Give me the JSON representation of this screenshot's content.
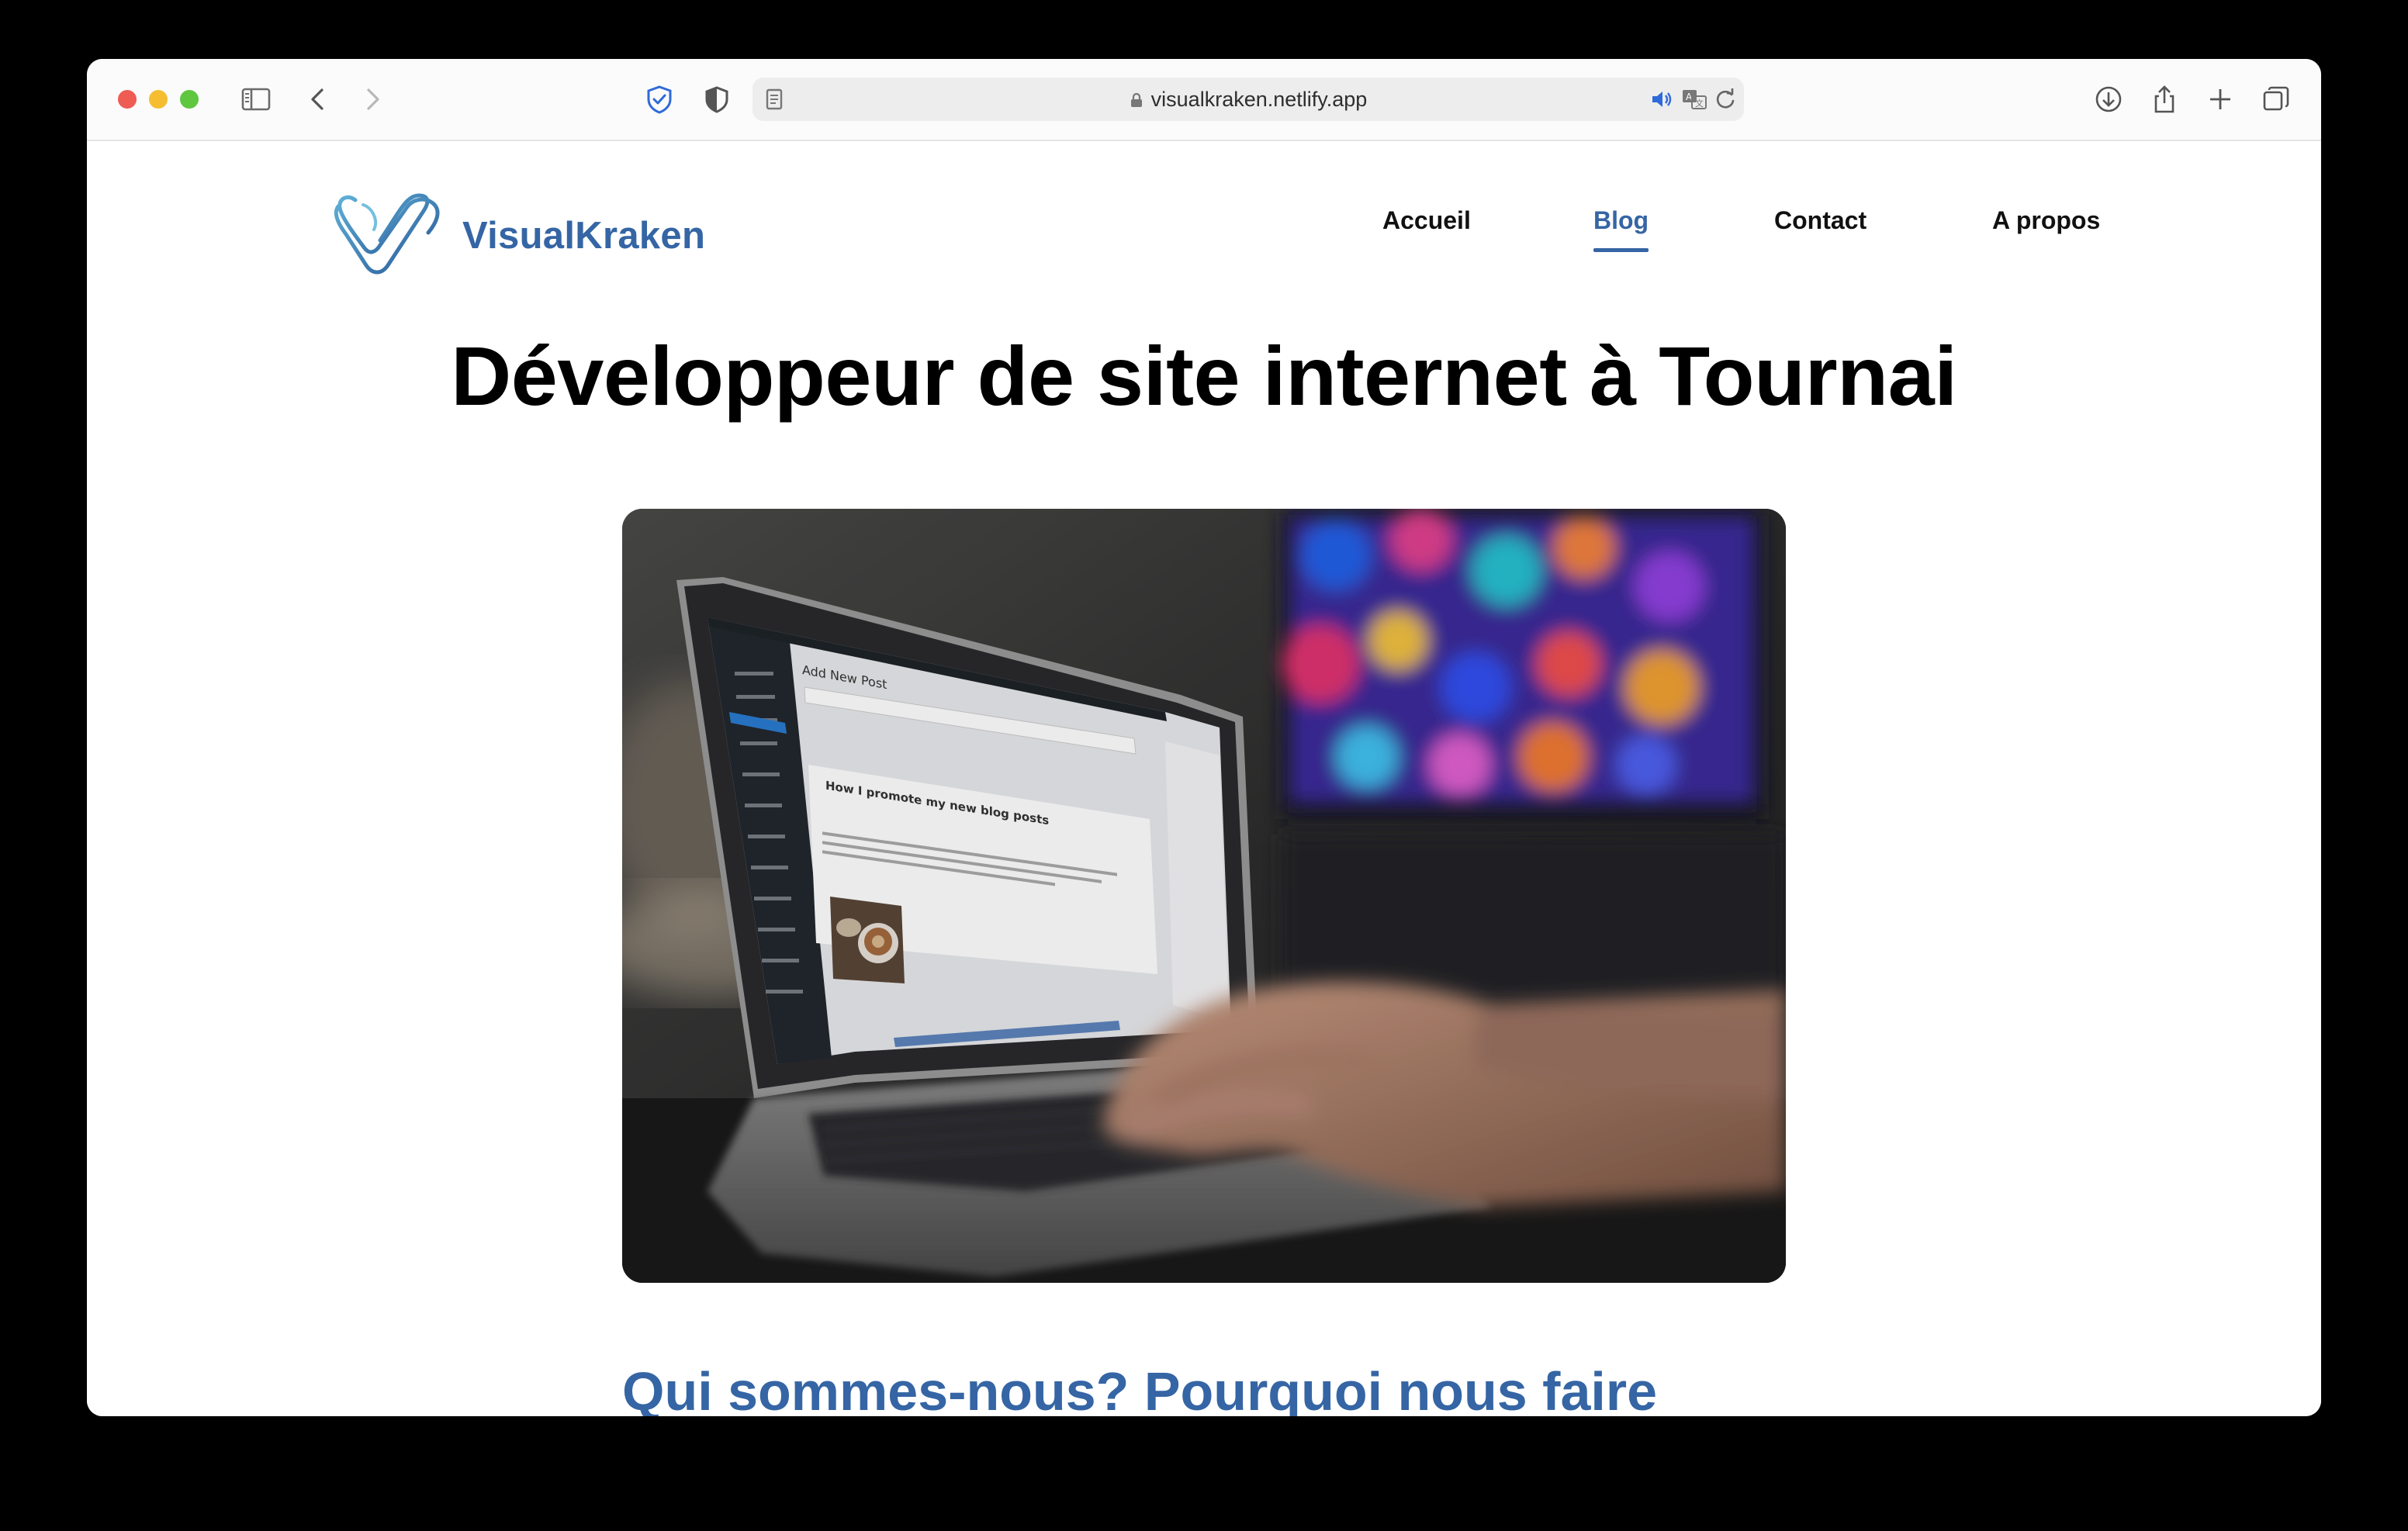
{
  "browser": {
    "url": "visualkraken.netlify.app"
  },
  "site": {
    "brand": "VisualKraken",
    "nav": [
      {
        "label": "Accueil",
        "active": false
      },
      {
        "label": "Blog",
        "active": true
      },
      {
        "label": "Contact",
        "active": false
      },
      {
        "label": "A propos",
        "active": false
      }
    ],
    "accent_color": "#3565a4"
  },
  "main": {
    "title": "Développeur de site internet à Tournai",
    "hero_image": "laptop-typing-photo",
    "section_heading": "Qui sommes-nous? Pourquoi nous faire"
  },
  "hero_screen": {
    "heading": "Add New Post",
    "post_title": "How I promote my new blog posts"
  }
}
